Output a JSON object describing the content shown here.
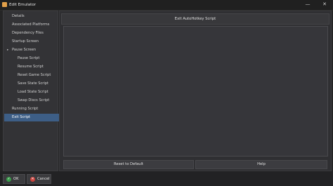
{
  "window": {
    "title": "Edit Emulator",
    "icon": "app-icon",
    "minimize_glyph": "—",
    "close_glyph": "✕"
  },
  "sidebar": {
    "items": [
      {
        "label": "Details"
      },
      {
        "label": "Associated Platforms"
      },
      {
        "label": "Dependency Files"
      },
      {
        "label": "Startup Screen"
      },
      {
        "label": "Pause Screen",
        "expanded": true
      },
      {
        "label": "Pause Script"
      },
      {
        "label": "Resume Script"
      },
      {
        "label": "Reset Game Script"
      },
      {
        "label": "Save State Script"
      },
      {
        "label": "Load State Script"
      },
      {
        "label": "Swap Discs Script"
      },
      {
        "label": "Running Script"
      },
      {
        "label": "Exit Script",
        "selected": true
      }
    ],
    "expand_glyph": "▸"
  },
  "main": {
    "header": "Exit AutoHotkey Script",
    "script_text": "",
    "reset_label": "Reset to Default",
    "help_label": "Help"
  },
  "footer": {
    "ok_label": "OK",
    "ok_glyph": "✓",
    "cancel_label": "Cancel",
    "cancel_glyph": "✕"
  },
  "colors": {
    "selected": "#3d5e86",
    "ok": "#3a9c4b",
    "cancel": "#c9433d"
  }
}
